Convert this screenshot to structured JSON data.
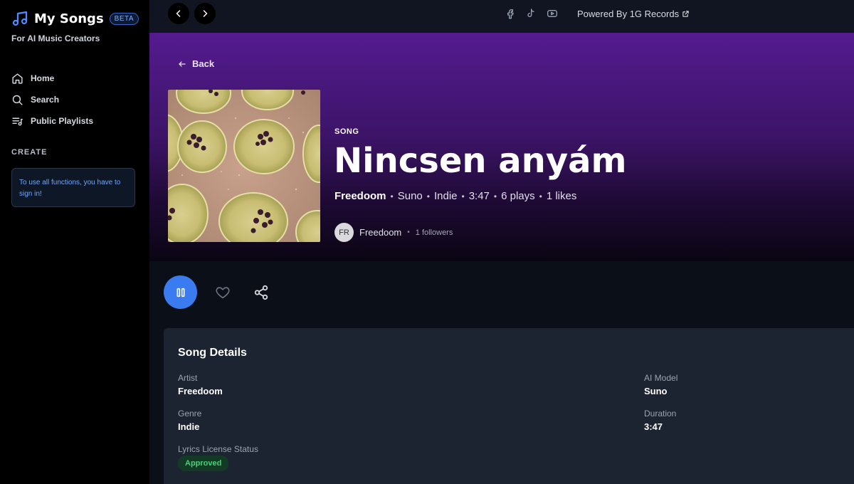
{
  "sidebar": {
    "brand_title": "My Songs",
    "beta_badge": "BETA",
    "tagline": "For AI Music Creators",
    "nav": [
      {
        "label": "Home",
        "icon": "home-icon"
      },
      {
        "label": "Search",
        "icon": "search-icon"
      },
      {
        "label": "Public Playlists",
        "icon": "playlist-icon"
      }
    ],
    "create_label": "CREATE",
    "signin_notice": "To use all functions, you have to sign in!"
  },
  "topbar": {
    "social_icons": [
      "facebook-icon",
      "tiktok-icon",
      "youtube-icon"
    ],
    "powered_by": "Powered By 1G Records"
  },
  "hero": {
    "back_label": "Back",
    "type_label": "SONG",
    "title": "Nincsen anyám",
    "meta": {
      "artist": "Freedoom",
      "ai_model": "Suno",
      "genre": "Indie",
      "duration": "3:47",
      "plays": "6 plays",
      "likes": "1 likes"
    },
    "artist_avatar_initials": "FR",
    "artist_name": "Freedoom",
    "followers": "1 followers"
  },
  "details": {
    "title": "Song Details",
    "artist_label": "Artist",
    "artist_value": "Freedoom",
    "ai_model_label": "AI Model",
    "ai_model_value": "Suno",
    "genre_label": "Genre",
    "genre_value": "Indie",
    "duration_label": "Duration",
    "duration_value": "3:47",
    "license_label": "Lyrics License Status",
    "license_value": "Approved"
  },
  "colors": {
    "accent_blue": "#3a7cf0",
    "hero_purple": "#541b8f",
    "approved_green": "#46d17a"
  }
}
